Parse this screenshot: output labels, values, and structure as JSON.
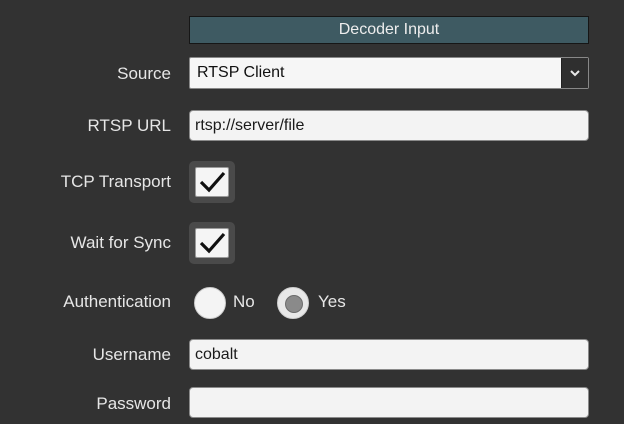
{
  "section": {
    "title": "Decoder Input"
  },
  "form": {
    "source": {
      "label": "Source",
      "value": "RTSP Client",
      "icon": "chevron-down-icon"
    },
    "rtsp_url": {
      "label": "RTSP URL",
      "value": "rtsp://server/file"
    },
    "tcp_transport": {
      "label": "TCP Transport",
      "checked": true
    },
    "wait_for_sync": {
      "label": "Wait for Sync",
      "checked": true
    },
    "authentication": {
      "label": "Authentication",
      "options": [
        "No",
        "Yes"
      ],
      "selected": "Yes"
    },
    "username": {
      "label": "Username",
      "value": "cobalt"
    },
    "password": {
      "label": "Password",
      "value": ""
    }
  },
  "colors": {
    "panel": "#323232",
    "header": "#3e5a62",
    "label_text": "#e6e6e6"
  }
}
